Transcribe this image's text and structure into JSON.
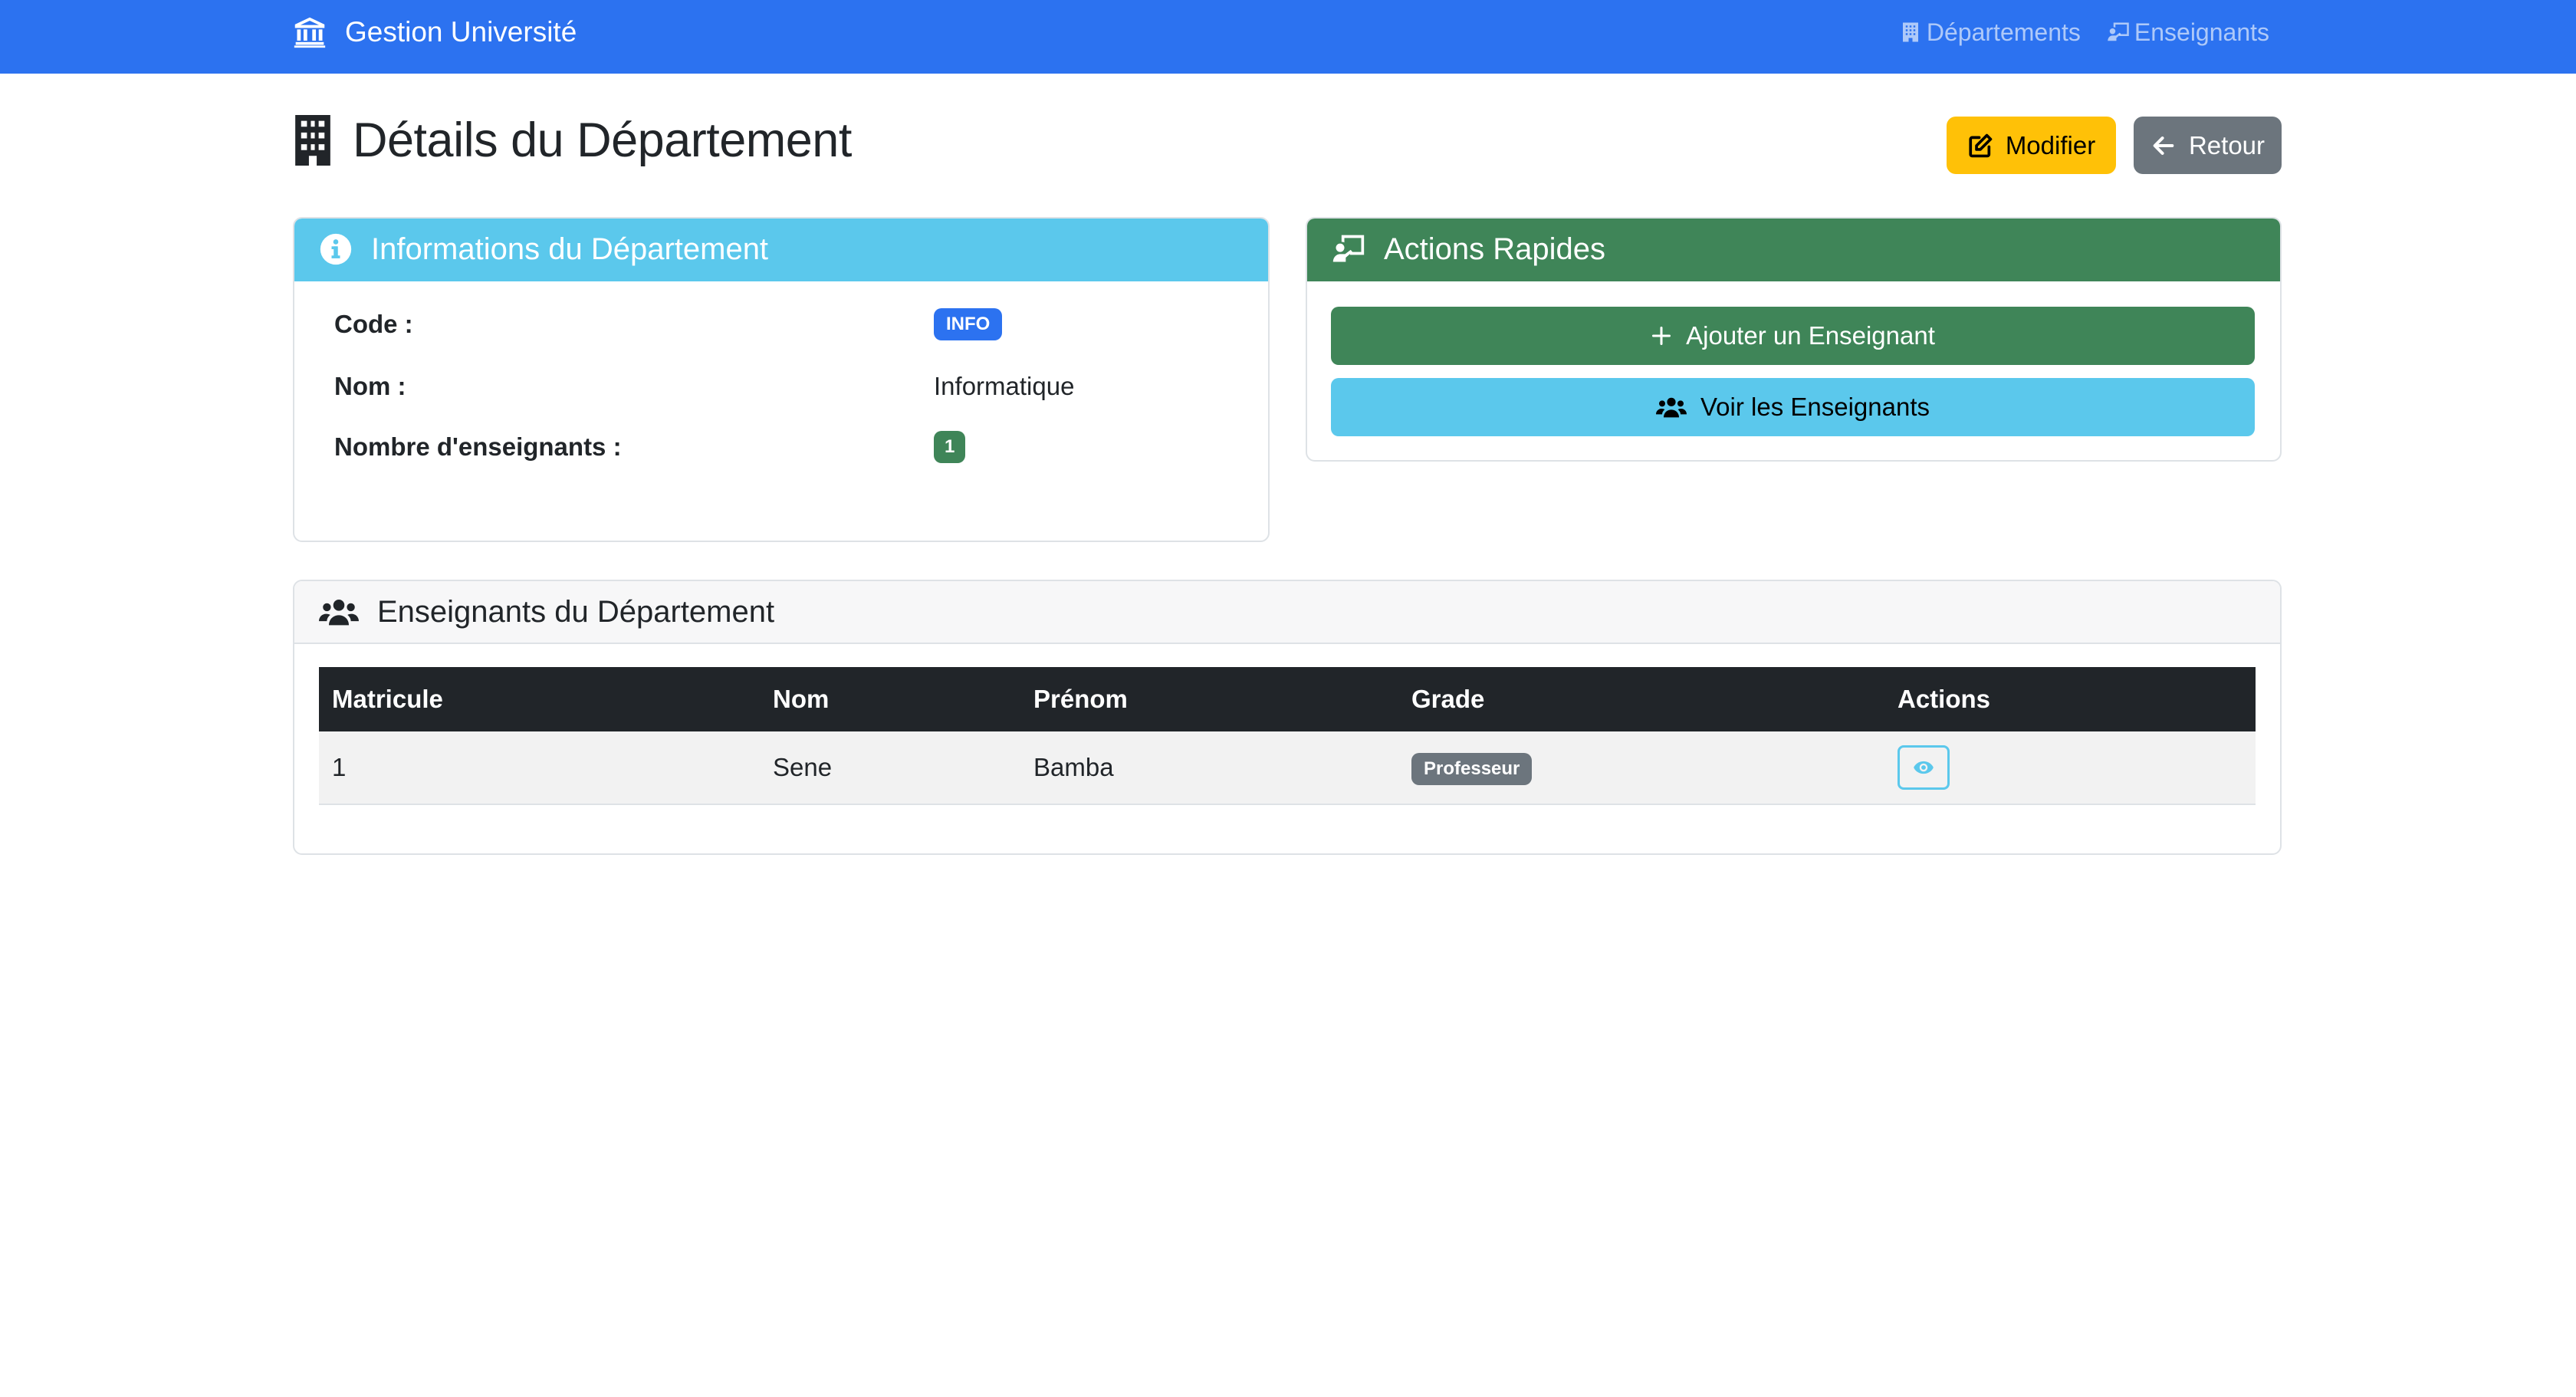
{
  "navbar": {
    "brand": "Gestion Université",
    "brand_icon": "university-icon",
    "links": [
      {
        "label": "Départements",
        "icon": "building-icon"
      },
      {
        "label": "Enseignants",
        "icon": "chalkboard-teacher-icon"
      }
    ],
    "bg_color": "#2c72f0"
  },
  "header": {
    "title": "Détails du Département",
    "icon": "building-icon",
    "edit_label": "Modifier",
    "back_label": "Retour"
  },
  "info_card": {
    "title": "Informations du Département",
    "rows": [
      {
        "label": "Code :",
        "value": "INFO"
      },
      {
        "label": "Nom :",
        "value": "Informatique"
      },
      {
        "label": "Nombre d'enseignants :",
        "value": "1"
      }
    ],
    "header_color": "#5bc8ec"
  },
  "actions_card": {
    "title": "Actions Rapides",
    "add_label": "Ajouter un Enseignant",
    "view_label": "Voir les Enseignants",
    "header_color": "#3f8558"
  },
  "teachers_card": {
    "title": "Enseignants du Département",
    "columns": [
      "Matricule",
      "Nom",
      "Prénom",
      "Grade",
      "Actions"
    ],
    "rows": [
      {
        "matricule": "1",
        "nom": "Sene",
        "prenom": "Bamba",
        "grade": "Professeur"
      }
    ]
  }
}
